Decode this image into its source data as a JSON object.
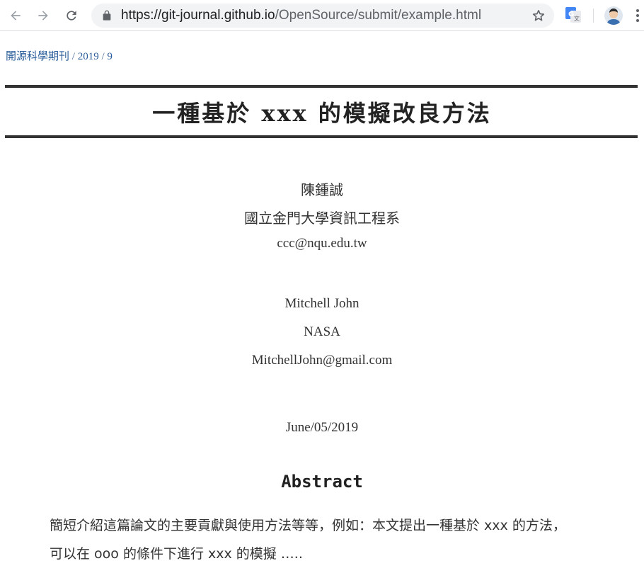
{
  "browser": {
    "url_host": "https://git-journal.github.io",
    "url_path": "/OpenSource/submit/example.html",
    "icons": [
      "back-icon",
      "forward-icon",
      "reload-icon",
      "lock-icon",
      "star-icon",
      "translate-icon",
      "avatar",
      "more-menu-icon"
    ]
  },
  "breadcrumb": {
    "journal": "開源科學期刊",
    "sep1": " / ",
    "year": "2019",
    "sep2": " / ",
    "issue": "9"
  },
  "paper": {
    "title": "一種基於 xxx 的模擬改良方法",
    "authors": [
      {
        "name": "陳鍾誠",
        "affiliation": "國立金門大學資訊工程系",
        "email": "ccc@nqu.edu.tw"
      },
      {
        "name": "Mitchell John",
        "affiliation": "NASA",
        "email": "MitchellJohn@gmail.com"
      }
    ],
    "date": "June/05/2019",
    "abstract_heading": "Abstract",
    "abstract_lines": [
      "簡短介紹這篇論文的主要貢獻與使用方法等等，例如：本文提出一種基於 xxx 的方法，",
      "可以在 ooo 的條件下進行 xxx 的模擬 ….."
    ]
  },
  "colors": {
    "link": "#2a5d9a",
    "text": "#333333",
    "rule": "#333333",
    "omnibox": "#f1f3f4"
  }
}
